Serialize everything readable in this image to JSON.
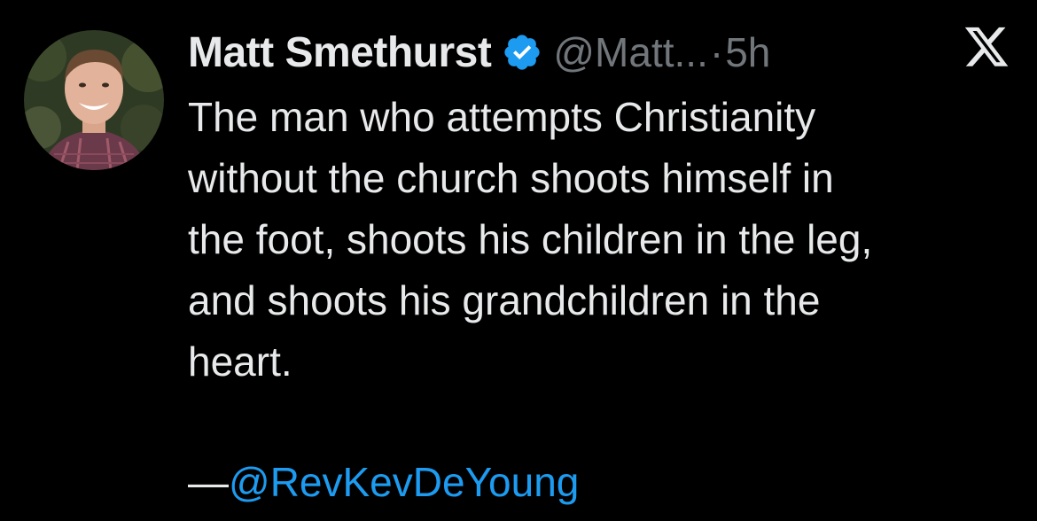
{
  "author": {
    "name": "Matt Smethurst",
    "handle": "@Matt...",
    "separator": "·",
    "time": "5h",
    "avatar_icon": "profile-photo",
    "verified_icon": "verified-badge-icon"
  },
  "platform_icon": "x-logo-icon",
  "tweet": {
    "text": "The man who attempts Christianity\nwithout the church shoots himself in\nthe foot, shoots his children in the leg,\nand shoots his grandchildren in the\nheart.",
    "attribution_dash": "—",
    "attribution_mention": "@RevKevDeYoung"
  },
  "colors": {
    "background": "#000000",
    "text": "#e7e9ea",
    "muted": "#71767b",
    "accent": "#1d9bf0"
  }
}
